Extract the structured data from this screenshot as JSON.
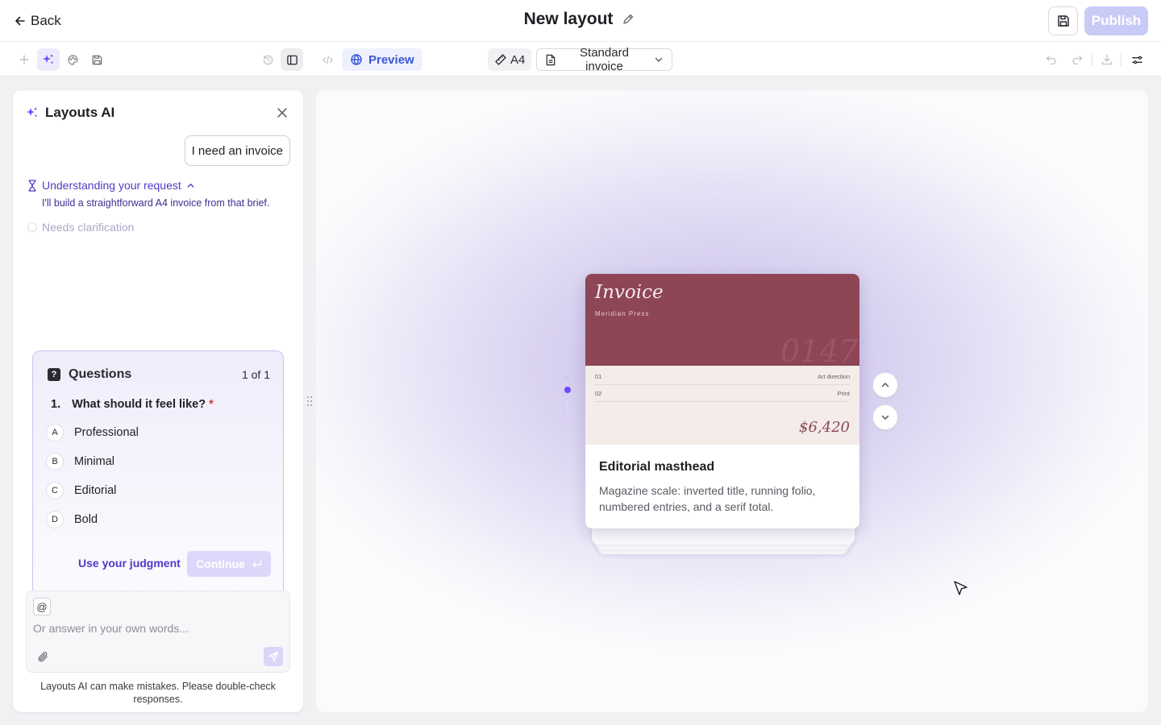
{
  "header": {
    "back_label": "Back",
    "title": "New layout",
    "publish_label": "Publish"
  },
  "toolbar": {
    "preview_label": "Preview",
    "page_size": "A4",
    "template": "Standard invoice"
  },
  "ai_panel": {
    "title": "Layouts AI",
    "user_message": "I need an invoice",
    "status_title": "Understanding your request",
    "status_detail": "I'll build a straightforward A4 invoice from that brief.",
    "step_pending": "Needs clarification",
    "questions": {
      "title": "Questions",
      "badge": "?",
      "count": "1 of 1",
      "number": "1.",
      "question": "What should it feel like?",
      "required_mark": "*",
      "options": [
        {
          "letter": "A",
          "label": "Professional"
        },
        {
          "letter": "B",
          "label": "Minimal"
        },
        {
          "letter": "C",
          "label": "Editorial"
        },
        {
          "letter": "D",
          "label": "Bold"
        }
      ],
      "judgment_label": "Use your judgment",
      "continue_label": "Continue"
    },
    "composer": {
      "mention": "@",
      "placeholder": "Or answer in your own words..."
    },
    "disclaimer": "Layouts AI can make mistakes. Please double-check responses."
  },
  "preview_card": {
    "invoice_title": "Invoice",
    "invoice_company": "Meridian Press",
    "invoice_folio": "0147",
    "rows": [
      {
        "num": "01",
        "item": "Art direction"
      },
      {
        "num": "02",
        "item": "Print"
      }
    ],
    "total": "$6,420",
    "name": "Editorial masthead",
    "description": "Magazine scale: inverted title, running folio, numbered entries, and a serif total."
  },
  "colors": {
    "accent": "#6d4aff",
    "publish_disabled": "#c9cbf7",
    "invoice_head": "#8e4556"
  }
}
